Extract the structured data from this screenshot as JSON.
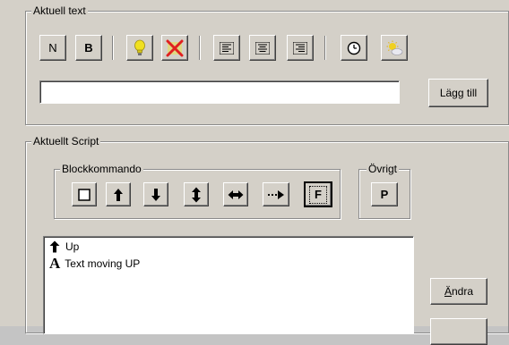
{
  "aktuell_text": {
    "legend": "Aktuell text",
    "toolbar": [
      {
        "key": "normal",
        "label": "N",
        "icon": "normal-text-icon"
      },
      {
        "key": "bold",
        "label": "B",
        "icon": "bold-text-icon"
      },
      {
        "key": "highlight",
        "icon": "lightbulb-icon"
      },
      {
        "key": "clear",
        "icon": "red-x-icon"
      },
      {
        "key": "align_left",
        "icon": "align-left-icon"
      },
      {
        "key": "align_center",
        "icon": "align-center-icon"
      },
      {
        "key": "align_right",
        "icon": "align-right-icon"
      },
      {
        "key": "time",
        "icon": "clock-icon"
      },
      {
        "key": "weather",
        "icon": "sun-cloud-icon"
      }
    ],
    "input_value": "",
    "add_label": "Lägg till"
  },
  "aktuellt_script": {
    "legend": "Aktuellt Script",
    "block_legend": "Blockkommando",
    "block_buttons": [
      {
        "key": "box",
        "icon": "square-icon"
      },
      {
        "key": "up",
        "icon": "arrow-up-icon"
      },
      {
        "key": "down",
        "icon": "arrow-down-icon"
      },
      {
        "key": "updown",
        "icon": "arrow-up-down-icon"
      },
      {
        "key": "leftright",
        "icon": "arrow-left-right-icon"
      },
      {
        "key": "dotted_right",
        "icon": "dotted-arrow-right-icon"
      },
      {
        "key": "frame",
        "label": "F",
        "icon": "framed-f-icon"
      }
    ],
    "ovrigt_legend": "Övrigt",
    "ovrigt_button_label": "P",
    "list": [
      {
        "icon": "arrow-up-icon",
        "text": "Up"
      },
      {
        "icon": "letter-a-icon",
        "glyph": "A",
        "text": "Text moving UP"
      }
    ],
    "andra_label": "Ändra",
    "andra_access_key": "Ä",
    "andra_rest": "ndra"
  },
  "colors": {
    "face": "#d4d0c8",
    "outer": "#c4c4c4",
    "bulb": "#f0e020",
    "x": "#e02020"
  }
}
